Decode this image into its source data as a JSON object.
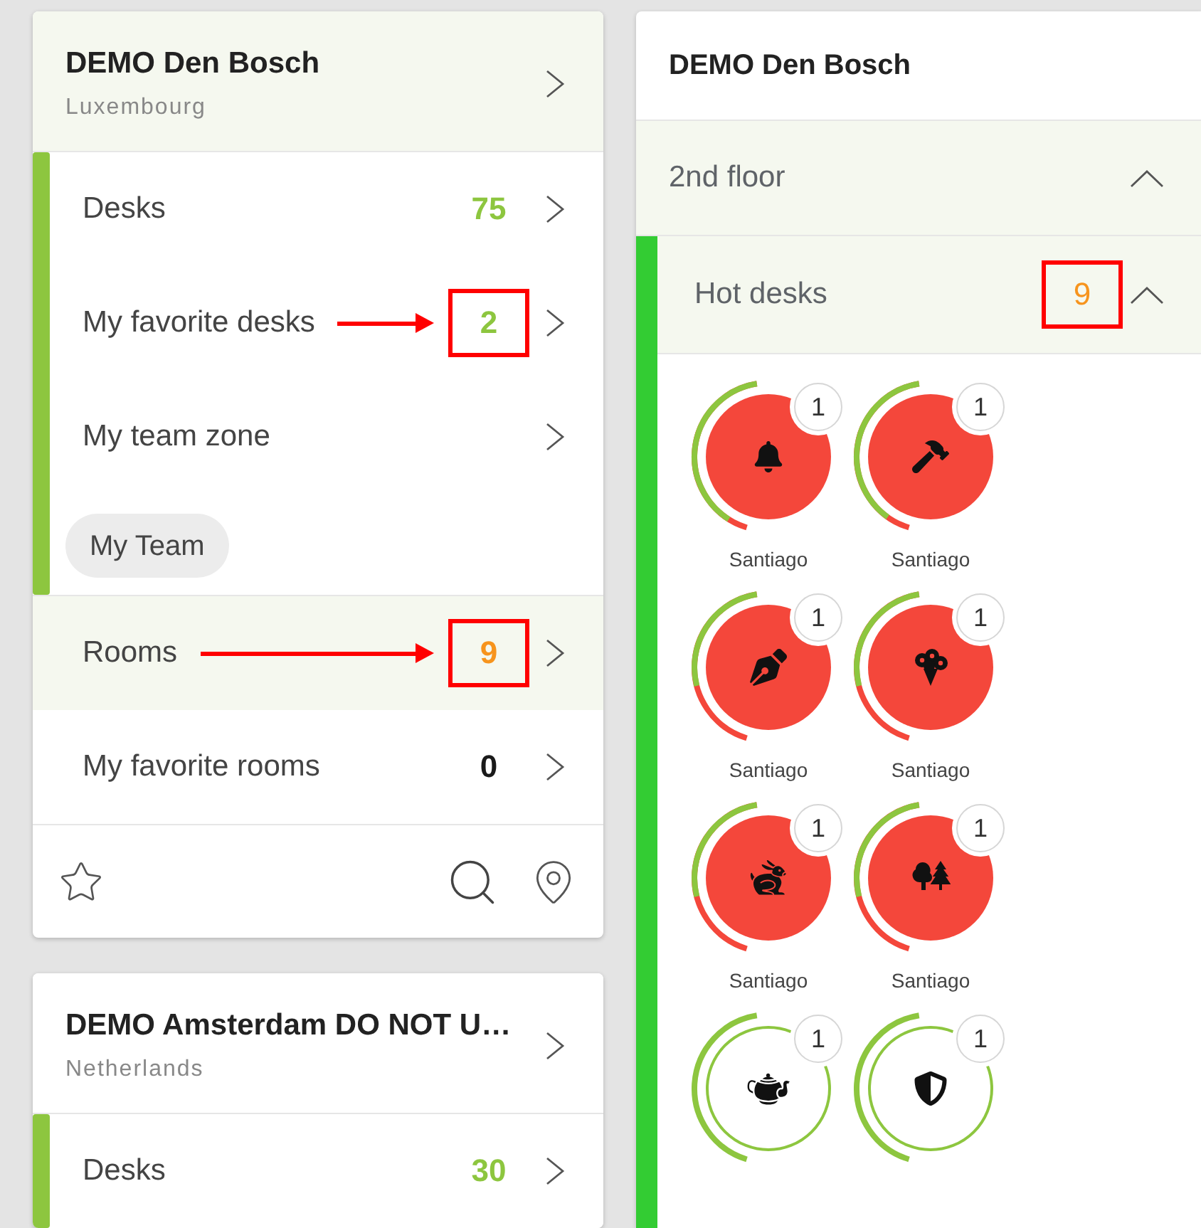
{
  "left_panel": {
    "buildings": [
      {
        "name": "DEMO Den Bosch",
        "country": "Luxembourg",
        "selected": true,
        "toolbar": true,
        "groups": [
          {
            "kind": "desks",
            "rows": [
              {
                "label": "Desks",
                "count": "75",
                "color": "#8dc63f",
                "selected": false,
                "boxed": false,
                "arrow": false
              },
              {
                "label": "My favorite desks",
                "count": "2",
                "color": "#8dc63f",
                "selected": false,
                "boxed": true,
                "arrow": true
              },
              {
                "label": "My team zone",
                "selected": false,
                "boxed": false,
                "arrow": false
              }
            ],
            "chip": "My Team"
          },
          {
            "kind": "rooms",
            "rows": [
              {
                "label": "Rooms",
                "count": "9",
                "color": "#f7941d",
                "selected": true,
                "boxed": true,
                "arrow": true
              },
              {
                "label": "My favorite rooms",
                "count": "0",
                "color": "#1a1a1a",
                "selected": false,
                "boxed": false,
                "arrow": false
              }
            ]
          }
        ]
      },
      {
        "name": "DEMO Amsterdam DO NOT U…",
        "country": "Netherlands",
        "selected": false,
        "groups": [
          {
            "kind": "desks",
            "rows": [
              {
                "label": "Desks",
                "count": "30",
                "color": "#8dc63f",
                "selected": false,
                "boxed": false,
                "arrow": false
              }
            ]
          }
        ]
      }
    ]
  },
  "right_panel": {
    "title": "DEMO Den Bosch",
    "floors": [
      {
        "name": "2nd floor",
        "expanded": true,
        "zones": [
          {
            "name": "Hot desks",
            "count": "9",
            "color": "#f7941d",
            "boxed": true,
            "expanded": true,
            "desks": [
              {
                "occupied": true,
                "level": 0.9,
                "badge": "1",
                "occupant": "Santiago"
              },
              {
                "occupied": true,
                "level": 0.88,
                "badge": "1",
                "occupant": "Santiago"
              },
              {
                "occupied": true,
                "level": 0.62,
                "badge": "1",
                "occupant": "Santiago"
              },
              {
                "occupied": true,
                "level": 0.62,
                "badge": "1",
                "occupant": "Santiago"
              },
              {
                "occupied": true,
                "level": 0.62,
                "badge": "1",
                "occupant": "Santiago"
              },
              {
                "occupied": true,
                "level": 0.62,
                "badge": "1",
                "occupant": "Santiago"
              },
              {
                "occupied": false,
                "level": 1,
                "badge": "1"
              },
              {
                "occupied": false,
                "level": 1,
                "badge": "1"
              }
            ]
          }
        ]
      }
    ]
  }
}
